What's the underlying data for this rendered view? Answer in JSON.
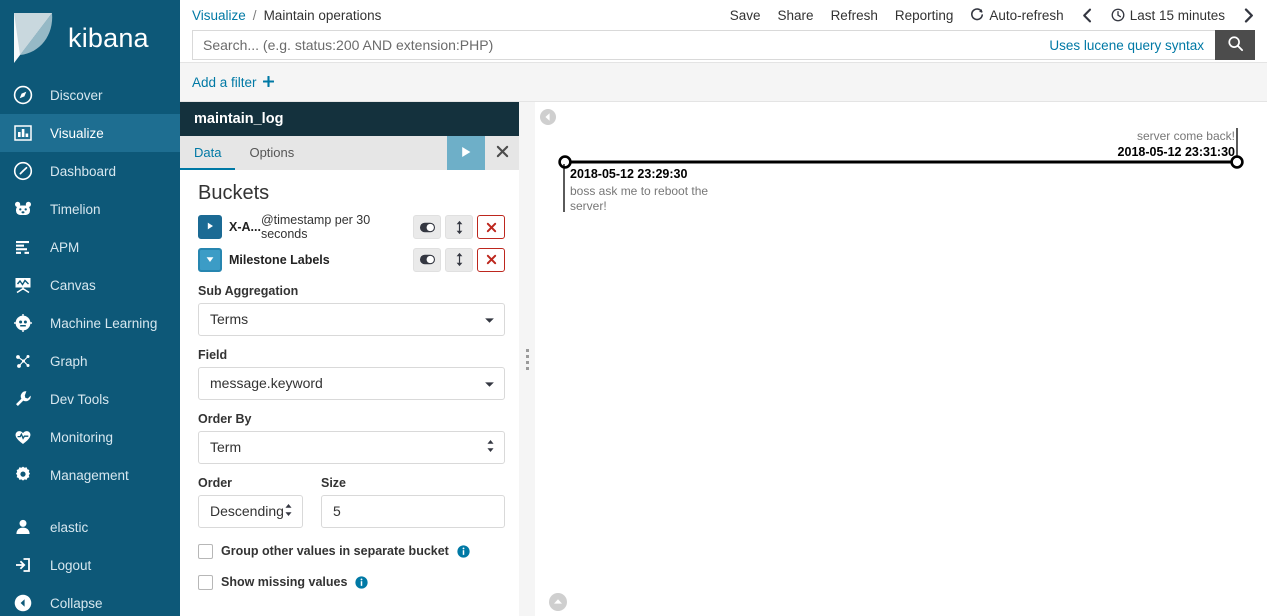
{
  "brand": {
    "name": "kibana",
    "logo_icon": "kibana-logo-icon"
  },
  "sidebar": {
    "items": [
      {
        "label": "Discover",
        "icon": "compass-icon",
        "active": false
      },
      {
        "label": "Visualize",
        "icon": "bar-chart-icon",
        "active": true
      },
      {
        "label": "Dashboard",
        "icon": "dashboard-gauge-icon",
        "active": false
      },
      {
        "label": "Timelion",
        "icon": "timelion-bear-icon",
        "active": false
      },
      {
        "label": "APM",
        "icon": "apm-bars-icon",
        "active": false
      },
      {
        "label": "Canvas",
        "icon": "canvas-icon",
        "active": false
      },
      {
        "label": "Machine Learning",
        "icon": "machine-learning-icon",
        "active": false
      },
      {
        "label": "Graph",
        "icon": "graph-nodes-icon",
        "active": false
      },
      {
        "label": "Dev Tools",
        "icon": "wrench-icon",
        "active": false
      },
      {
        "label": "Monitoring",
        "icon": "heart-pulse-icon",
        "active": false
      },
      {
        "label": "Management",
        "icon": "gear-icon",
        "active": false
      }
    ],
    "footer_items": [
      {
        "label": "elastic",
        "icon": "user-icon"
      },
      {
        "label": "Logout",
        "icon": "logout-icon"
      },
      {
        "label": "Collapse",
        "icon": "collapse-left-icon"
      }
    ]
  },
  "breadcrumb": {
    "parent": "Visualize",
    "separator": "/",
    "current": "Maintain operations"
  },
  "top_actions": [
    {
      "label": "Save",
      "icon": ""
    },
    {
      "label": "Share",
      "icon": ""
    },
    {
      "label": "Refresh",
      "icon": ""
    },
    {
      "label": "Reporting",
      "icon": ""
    },
    {
      "label": "Auto-refresh",
      "icon": "refresh-cycle-icon"
    },
    {
      "label": "Last 15 minutes",
      "icon": "clock-icon"
    }
  ],
  "time_nav": {
    "prev_icon": "chevron-left-icon",
    "next_icon": "chevron-right-icon"
  },
  "search": {
    "value": "",
    "placeholder": "Search... (e.g. status:200 AND extension:PHP)",
    "hint": "Uses lucene query syntax",
    "button_icon": "search-icon"
  },
  "filter_bar": {
    "add_filter_label": "Add a filter",
    "add_filter_icon": "plus-icon"
  },
  "editor": {
    "title": "maintain_log",
    "tabs": [
      {
        "label": "Data",
        "active": true
      },
      {
        "label": "Options",
        "active": false
      }
    ],
    "apply_icon": "play-apply-icon",
    "cancel_icon": "close-x-icon",
    "buckets_heading": "Buckets",
    "bucket_rows": [
      {
        "key": "X-A...",
        "value": "@timestamp per 30 seconds",
        "expanded": false,
        "toggle_icon": "triangle-right-icon",
        "enable_icon": "toggle-switch-icon",
        "move_icon": "move-updown-icon",
        "remove_icon": "remove-x-icon"
      },
      {
        "key": "Milestone Labels",
        "value": "",
        "expanded": true,
        "toggle_icon": "triangle-down-icon",
        "enable_icon": "toggle-switch-icon",
        "move_icon": "move-updown-icon",
        "remove_icon": "remove-x-icon"
      }
    ],
    "fields": {
      "sub_aggregation_label": "Sub Aggregation",
      "sub_aggregation_value": "Terms",
      "field_label": "Field",
      "field_value": "message.keyword",
      "order_by_label": "Order By",
      "order_by_value": "Term",
      "order_label": "Order",
      "order_value": "Descending",
      "size_label": "Size",
      "size_value": "5"
    },
    "checkboxes": [
      {
        "label": "Group other values in separate bucket",
        "checked": false,
        "info_icon": "info-icon"
      },
      {
        "label": "Show missing values",
        "checked": false,
        "info_icon": "info-icon"
      }
    ]
  },
  "visualization": {
    "type": "timeline",
    "collapse_icon": "collapse-circle-left-icon",
    "bottom_icon": "chevron-up-circle-icon",
    "milestones": [
      {
        "timestamp": "2018-05-12 23:29:30",
        "message": "boss ask me to reboot the server!",
        "position": "below",
        "x_fraction": 0.0
      },
      {
        "timestamp": "2018-05-12 23:31:30",
        "message": "server come back!",
        "position": "above",
        "x_fraction": 1.0
      }
    ]
  },
  "colors": {
    "sidebar_bg": "#0d5878",
    "sidebar_active": "#1e6e91",
    "link": "#0079a5",
    "editor_title_bg": "#14313d",
    "apply_btn": "#6eafc8",
    "danger": "#bd271e"
  }
}
